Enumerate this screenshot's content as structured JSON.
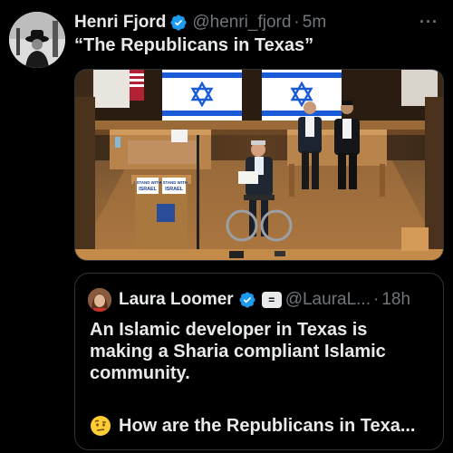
{
  "tweet": {
    "author_name": "Henri Fjord",
    "handle": "@henri_fjord",
    "separator": "·",
    "time": "5m",
    "more_icon": "more-horizontal-icon",
    "text": "“The Republicans in Texas”",
    "media": {
      "sign_line1": "I STAND WITH",
      "sign_line2": "ISRAEL"
    }
  },
  "quoted_tweet": {
    "author_name": "Laura Loomer",
    "badge_text": "=",
    "handle": "@LauraL...",
    "separator": "·",
    "time": "18h",
    "text": "An Islamic developer in Texas is making a Sharia compliant Islamic community.",
    "second_line": "How are the Republicans in Texa...",
    "emoji_icon": "face-with-raised-eyebrow-icon"
  },
  "colors": {
    "background": "#000000",
    "text_primary": "#e7e9ea",
    "text_secondary": "#71767b",
    "verified_blue": "#1d9bf0",
    "border": "#2f3336"
  }
}
